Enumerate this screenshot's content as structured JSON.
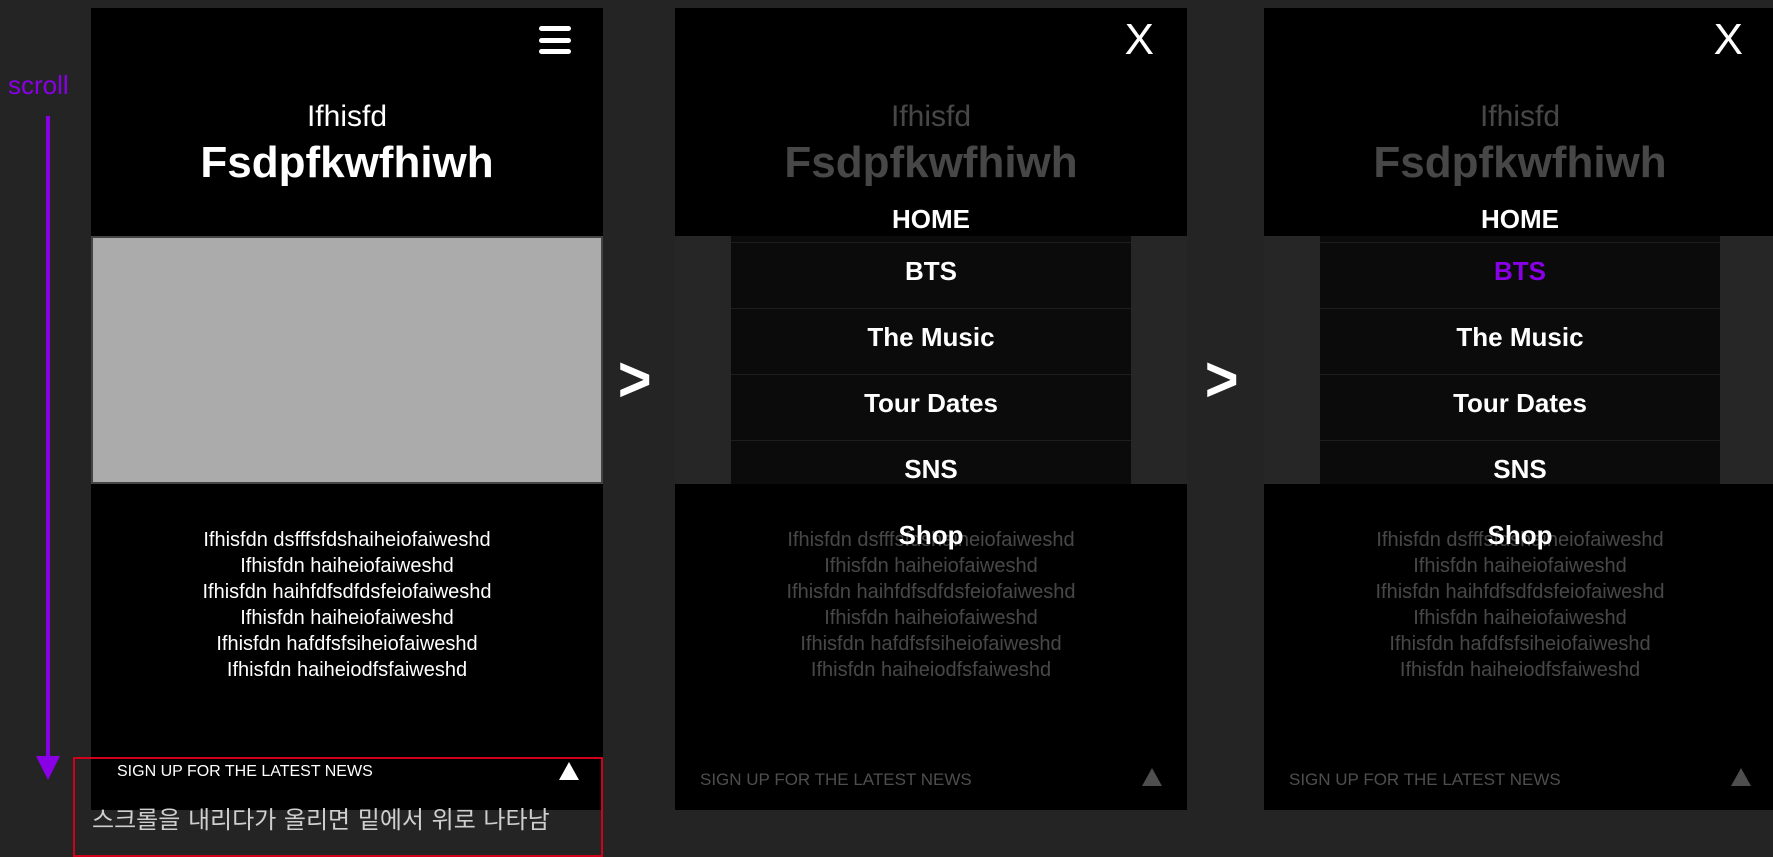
{
  "annotation": {
    "scroll_label": "scroll",
    "note": "스크롤을 내리다가 올리면 밑에서 위로 나타남",
    "accent_color": "#8a00e6",
    "highlight_color": "#d0021b"
  },
  "page": {
    "title_small": "Ifhisfd",
    "title_big": "Fsdpfkwfhiwh",
    "body_lines": [
      "Ifhisfdn dsfffsfdshaiheiofaiweshd",
      "Ifhisfdn haiheiofaiweshd",
      "Ifhisfdn haihfdfsdfdsfeiofaiweshd",
      "Ifhisfdn haiheiofaiweshd",
      "Ifhisfdn hafdfsfsiheiofaiweshd",
      "Ifhisfdn haiheiodfsfaiweshd"
    ],
    "newsletter_label": "SIGN UP FOR THE LATEST NEWS",
    "media_placeholder_color": "#ababab"
  },
  "menu": {
    "items": [
      "HOME",
      "BTS",
      "The Music",
      "Tour Dates",
      "SNS",
      "Shop"
    ],
    "close_label": "X",
    "active_item_frame3": "BTS"
  },
  "transition": {
    "arrow_label": ">"
  },
  "icons": {
    "menu": "hamburger-icon",
    "close": "close-icon",
    "scroll_top": "triangle-up-icon",
    "scroll_direction": "arrow-down-icon"
  }
}
